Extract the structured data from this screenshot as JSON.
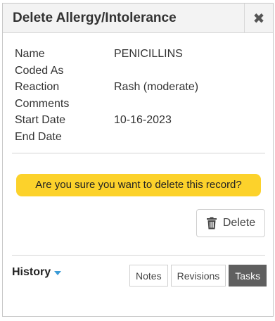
{
  "dialog": {
    "title": "Delete Allergy/Intolerance",
    "close_symbol": "✖"
  },
  "details": [
    {
      "label": "Name",
      "value": "PENICILLINS"
    },
    {
      "label": "Coded As",
      "value": ""
    },
    {
      "label": "Reaction",
      "value": "Rash (moderate)"
    },
    {
      "label": "Comments",
      "value": ""
    },
    {
      "label": "Start Date",
      "value": "10-16-2023"
    },
    {
      "label": "End Date",
      "value": ""
    }
  ],
  "confirm_message": "Are you sure you want to delete this record?",
  "delete_button": {
    "label": "Delete",
    "icon": "trash-icon"
  },
  "history": {
    "label": "History",
    "icon": "caret-down-icon"
  },
  "tabs": [
    {
      "label": "Notes",
      "active": false
    },
    {
      "label": "Revisions",
      "active": false
    },
    {
      "label": "Tasks",
      "active": true
    }
  ],
  "colors": {
    "warning_bg": "#fcd22b",
    "active_tab_bg": "#5f5f5f",
    "caret": "#3b9bd6"
  }
}
